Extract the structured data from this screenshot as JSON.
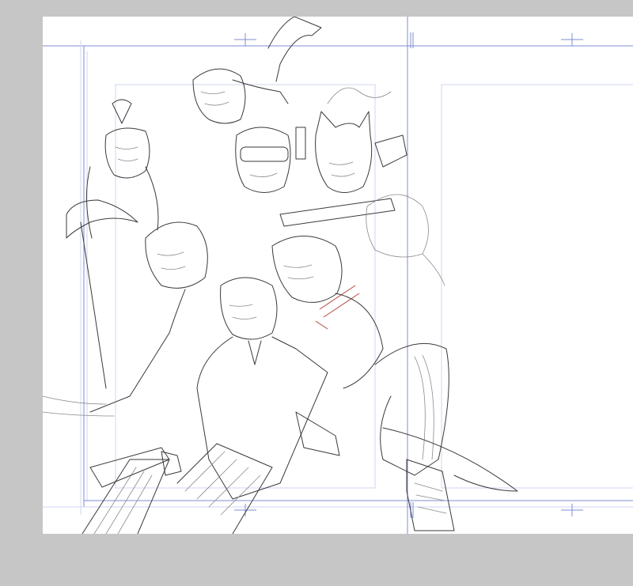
{
  "app": {
    "view": "manga-lineart-canvas"
  },
  "colors": {
    "workspace": "#c6c6c6",
    "paper": "#ffffff",
    "guide": "#7f8cd6",
    "lineart": "#3a3a3a",
    "accent_red": "#b04a3a"
  },
  "icons": {
    "register_marks": "crosshair-icon"
  }
}
